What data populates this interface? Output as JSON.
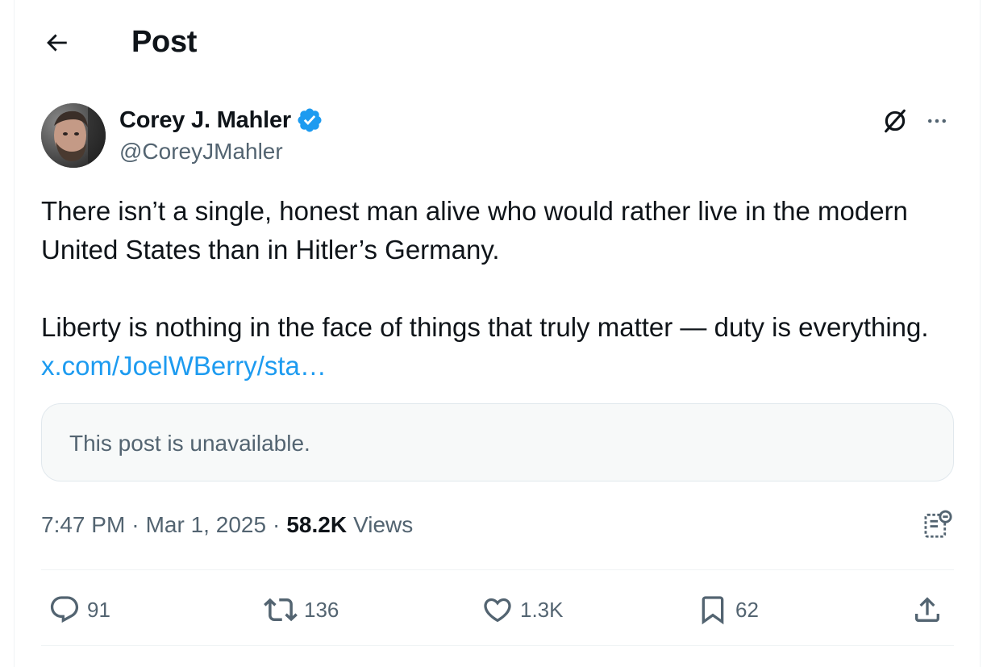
{
  "header": {
    "title": "Post"
  },
  "author": {
    "name": "Corey J. Mahler",
    "handle": "@CoreyJMahler",
    "verified": true
  },
  "post": {
    "paragraph1": "There isn’t a single, honest man alive who would rather live in the modern United States than in Hitler’s Germany.",
    "paragraph2": "Liberty is nothing in the face of things that truly matter — duty is everything.",
    "link_text": "x.com/JoelWBerry/sta…"
  },
  "quote": {
    "text": "This post is unavailable."
  },
  "meta": {
    "time": "7:47 PM",
    "separator": "·",
    "date": "Mar 1, 2025",
    "views_count": "58.2K",
    "views_label": "Views"
  },
  "actions": {
    "replies": "91",
    "reposts": "136",
    "likes": "1.3K",
    "bookmarks": "62"
  },
  "colors": {
    "accent": "#1d9bf0",
    "text_primary": "#0f1419",
    "text_secondary": "#536471",
    "divider": "#eff3f4"
  },
  "icons": [
    "back-arrow-icon",
    "verified-badge-icon",
    "grok-icon",
    "more-icon",
    "analytics-icon",
    "reply-icon",
    "repost-icon",
    "like-icon",
    "bookmark-icon",
    "share-icon"
  ]
}
